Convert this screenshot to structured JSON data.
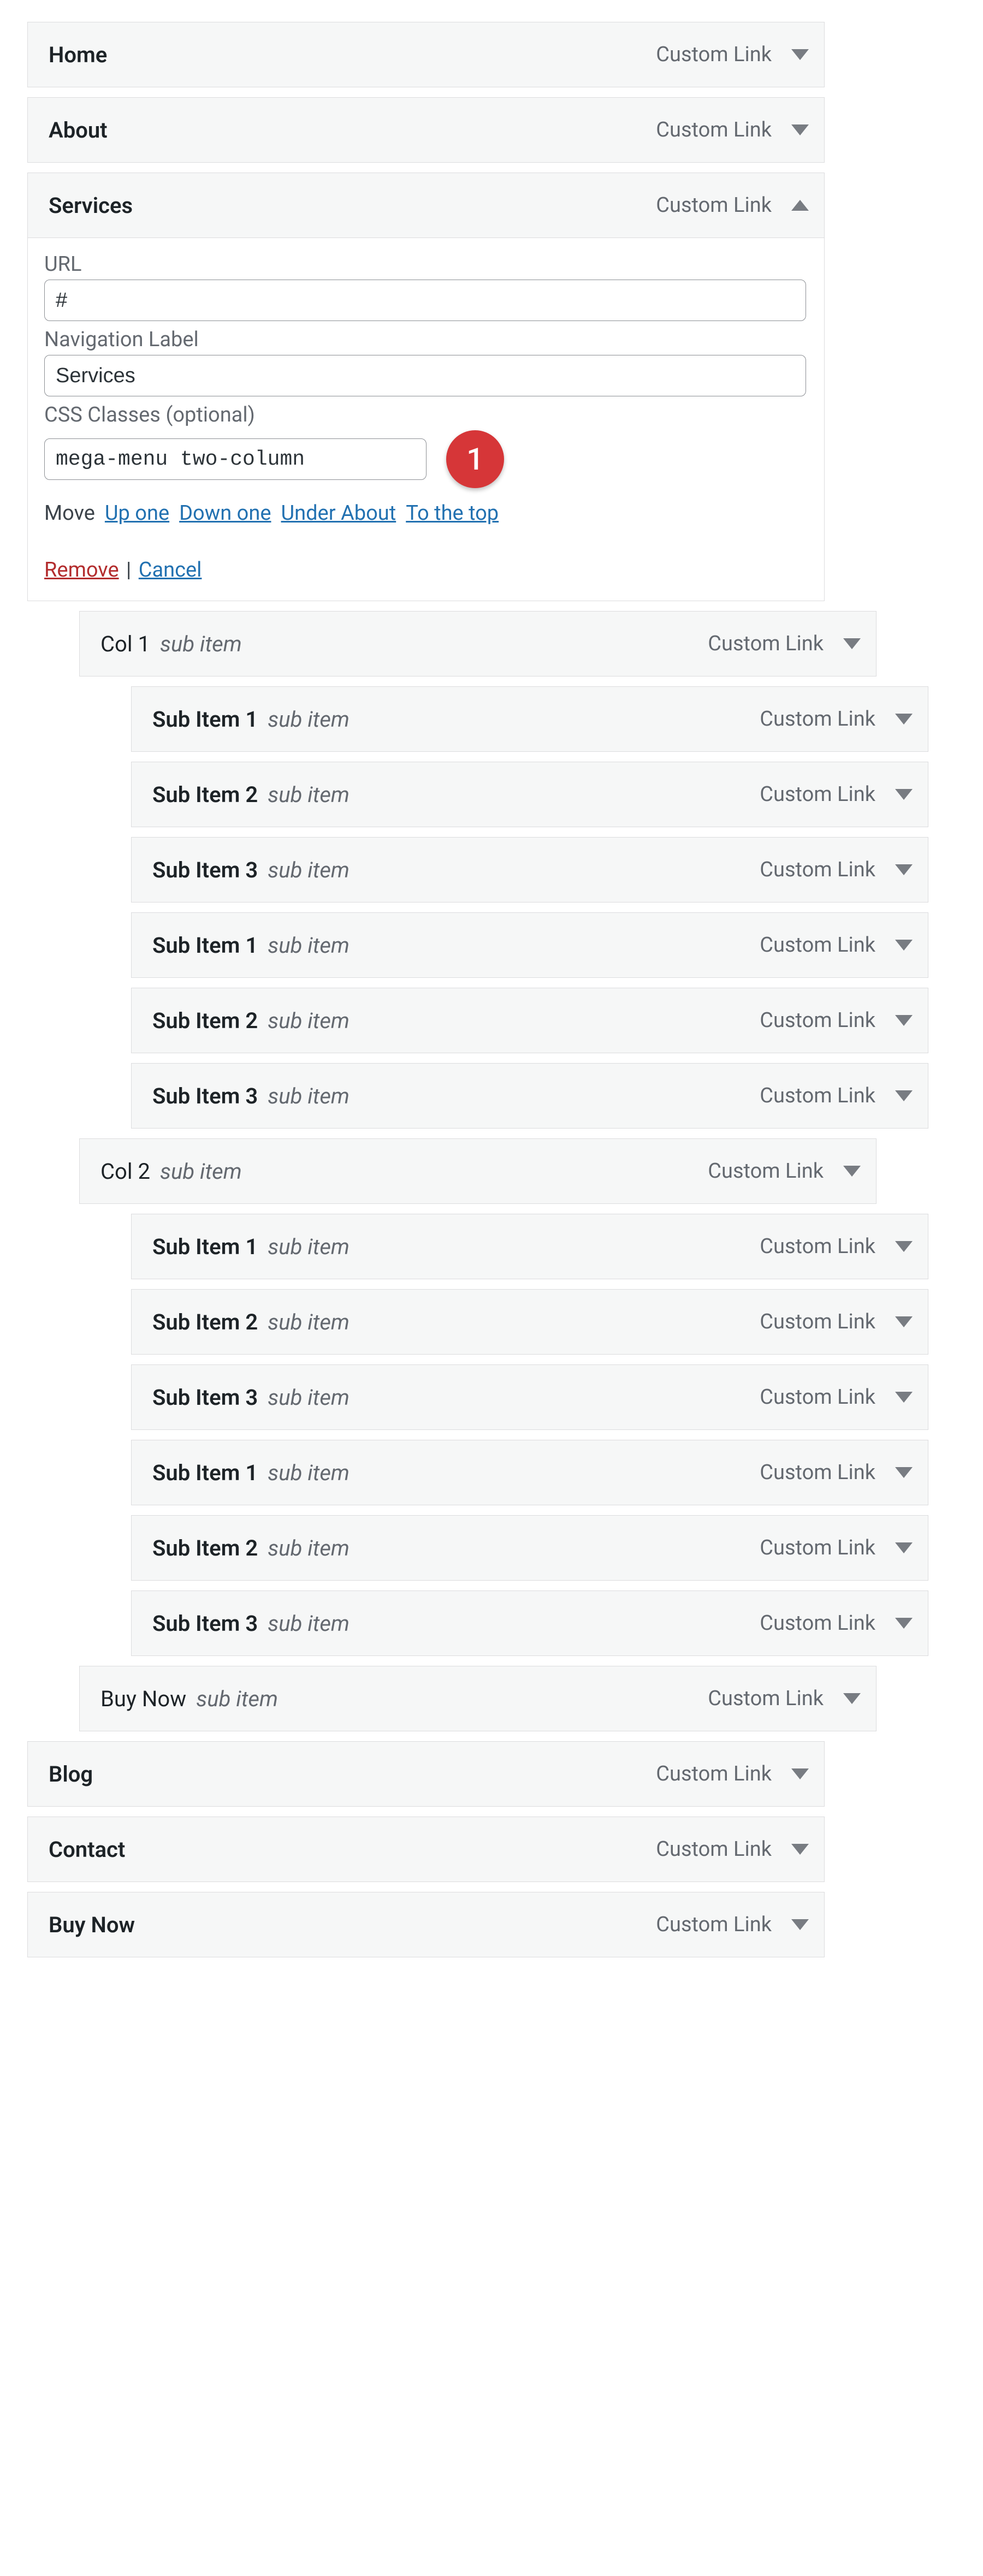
{
  "labels": {
    "type_custom_link": "Custom Link",
    "sub_item": "sub item",
    "url": "URL",
    "nav_label": "Navigation Label",
    "css_classes": "CSS Classes (optional)",
    "move": "Move",
    "up_one": "Up one",
    "down_one": "Down one",
    "under_prefix": "Under ",
    "to_top": "To the top",
    "remove": "Remove",
    "cancel": "Cancel",
    "badge_1": "1"
  },
  "expanded": {
    "title": "Services",
    "under_target": "About",
    "url_value": "#",
    "nav_label_value": "Services",
    "css_value": "mega-menu two-column"
  },
  "items": [
    {
      "title": "Home",
      "sub": false,
      "depth": 0,
      "expanded": false
    },
    {
      "title": "About",
      "sub": false,
      "depth": 0,
      "expanded": false
    },
    {
      "title": "Services",
      "sub": false,
      "depth": 0,
      "expanded": true
    },
    {
      "title": "Col 1",
      "sub": true,
      "depth": 1,
      "expanded": false
    },
    {
      "title": "Sub Item 1",
      "sub": true,
      "depth": 2,
      "expanded": false
    },
    {
      "title": "Sub Item 2",
      "sub": true,
      "depth": 2,
      "expanded": false
    },
    {
      "title": "Sub Item 3",
      "sub": true,
      "depth": 2,
      "expanded": false
    },
    {
      "title": "Sub Item 1",
      "sub": true,
      "depth": 2,
      "expanded": false
    },
    {
      "title": "Sub Item 2",
      "sub": true,
      "depth": 2,
      "expanded": false
    },
    {
      "title": "Sub Item 3",
      "sub": true,
      "depth": 2,
      "expanded": false
    },
    {
      "title": "Col 2",
      "sub": true,
      "depth": 1,
      "expanded": false
    },
    {
      "title": "Sub Item 1",
      "sub": true,
      "depth": 2,
      "expanded": false
    },
    {
      "title": "Sub Item 2",
      "sub": true,
      "depth": 2,
      "expanded": false
    },
    {
      "title": "Sub Item 3",
      "sub": true,
      "depth": 2,
      "expanded": false
    },
    {
      "title": "Sub Item 1",
      "sub": true,
      "depth": 2,
      "expanded": false
    },
    {
      "title": "Sub Item 2",
      "sub": true,
      "depth": 2,
      "expanded": false
    },
    {
      "title": "Sub Item 3",
      "sub": true,
      "depth": 2,
      "expanded": false
    },
    {
      "title": "Buy Now",
      "sub": true,
      "depth": 1,
      "expanded": false
    },
    {
      "title": "Blog",
      "sub": false,
      "depth": 0,
      "expanded": false
    },
    {
      "title": "Contact",
      "sub": false,
      "depth": 0,
      "expanded": false
    },
    {
      "title": "Buy Now",
      "sub": false,
      "depth": 0,
      "expanded": false
    }
  ]
}
